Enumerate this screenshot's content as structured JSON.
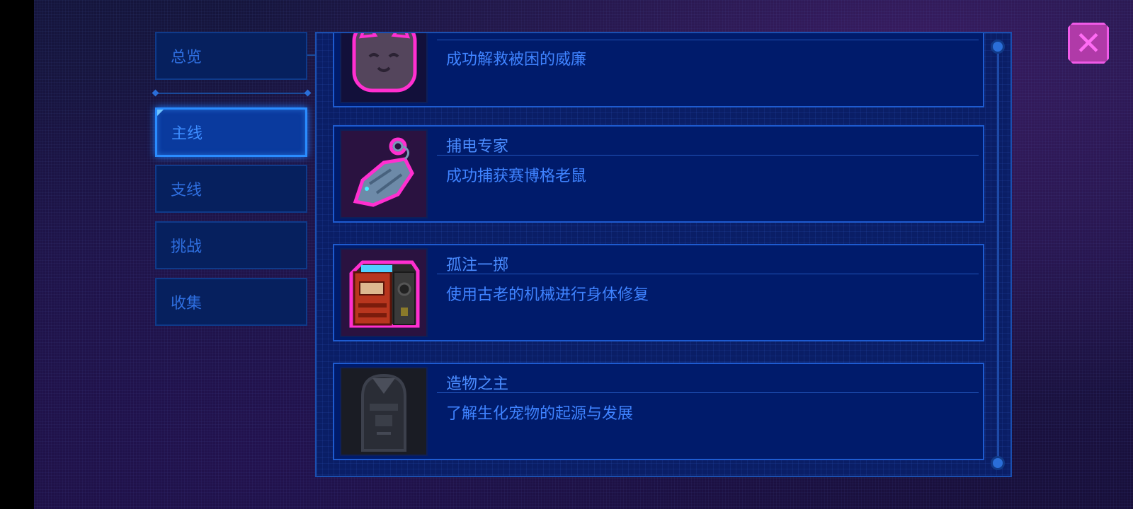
{
  "tabs": [
    {
      "label": "总览",
      "active": false
    },
    {
      "label": "主线",
      "active": true
    },
    {
      "label": "支线",
      "active": false
    },
    {
      "label": "挑战",
      "active": false
    },
    {
      "label": "收集",
      "active": false
    }
  ],
  "achievements": [
    {
      "title": "",
      "description": "成功解救被困的威廉",
      "icon": "cat-face-icon"
    },
    {
      "title": "捕电专家",
      "description": "成功捕获赛博格老鼠",
      "icon": "cyber-rat-icon"
    },
    {
      "title": "孤注一掷",
      "description": "使用古老的机械进行身体修复",
      "icon": "repair-machine-icon"
    },
    {
      "title": "造物之主",
      "description": "了解生化宠物的起源与发展",
      "icon": "android-face-icon"
    }
  ],
  "close": {
    "glyph": "✕"
  },
  "colors": {
    "accent": "#2a8cff",
    "text": "#4a8cff",
    "close": "#f05ae8"
  }
}
